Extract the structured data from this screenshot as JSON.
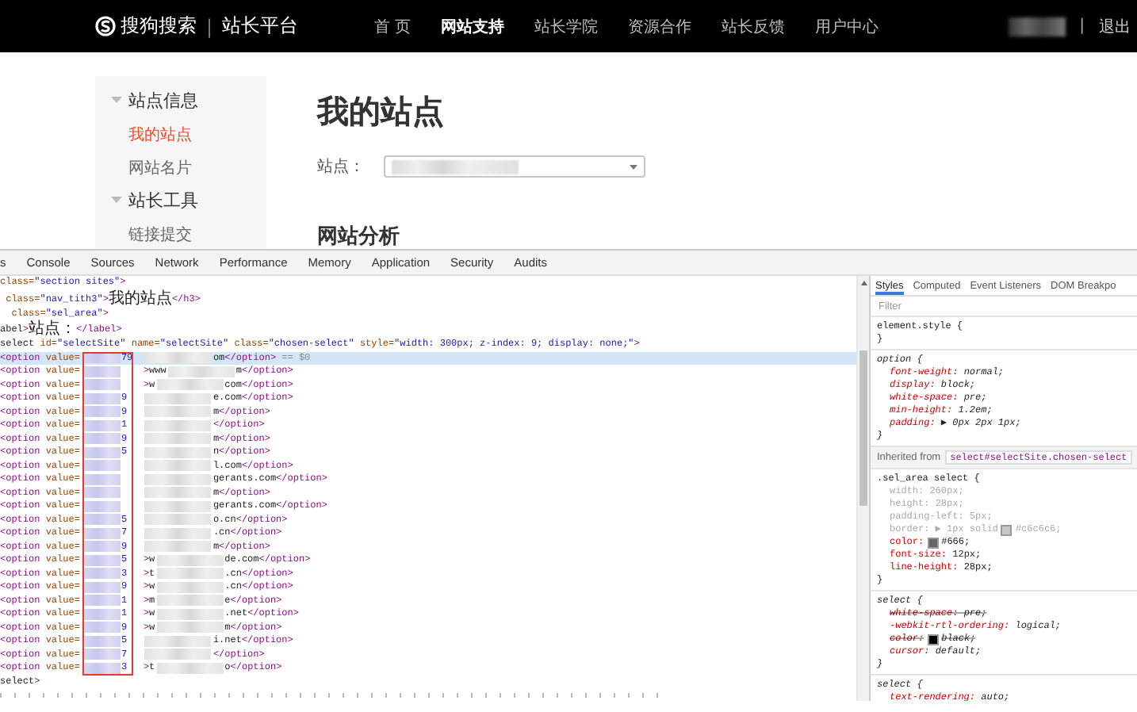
{
  "topbar": {
    "logo_text": "搜狗搜索",
    "divider": "|",
    "platform": "站长平台",
    "nav": [
      {
        "label": "首 页",
        "selected": false
      },
      {
        "label": "网站支持",
        "selected": true
      },
      {
        "label": "站长学院",
        "selected": false
      },
      {
        "label": "资源合作",
        "selected": false
      },
      {
        "label": "站长反馈",
        "selected": false
      },
      {
        "label": "用户中心",
        "selected": false
      }
    ],
    "separator": "|",
    "logout": "退出"
  },
  "sidebar": {
    "sections": [
      {
        "title": "站点信息",
        "expanded": true,
        "items": [
          {
            "label": "我的站点",
            "selected": true
          },
          {
            "label": "网站名片",
            "selected": false
          }
        ]
      },
      {
        "title": "站长工具",
        "expanded": true,
        "items": [
          {
            "label": "链接提交",
            "selected": false
          }
        ]
      }
    ]
  },
  "main": {
    "title": "我的站点",
    "site_label": "站点：",
    "analysis_title": "网站分析"
  },
  "devtools": {
    "tabs": [
      {
        "label": "s",
        "selected": false
      },
      {
        "label": "Console",
        "selected": false
      },
      {
        "label": "Sources",
        "selected": false
      },
      {
        "label": "Network",
        "selected": false
      },
      {
        "label": "Performance",
        "selected": false
      },
      {
        "label": "Memory",
        "selected": false
      },
      {
        "label": "Application",
        "selected": false
      },
      {
        "label": "Security",
        "selected": false
      },
      {
        "label": "Audits",
        "selected": false
      }
    ],
    "code_lines": [
      "class=\"section sites\">",
      " class=\"nav_tith3\">我的站点</h3>",
      "  class=\"sel_area\">",
      "abel>站点：</label>",
      "select id=\"selectSite\" name=\"selectSite\" class=\"chosen-select\" style=\"width: 300px; z-index: 9; display: none;\">"
    ],
    "options": [
      {
        "open": "<option value=",
        "value_end": "79",
        "text_end": "om</option> == $0",
        "selected": true
      },
      {
        "open": "<option value=",
        "text_start": ">www",
        "text_end": "m</option>",
        "selected": false
      },
      {
        "open": "<option value=",
        "text_start": ">w",
        "text_end": "com</option>",
        "selected": false
      },
      {
        "open": "<option value=",
        "value_end": "9",
        "text_end": "e.com</option>",
        "selected": false
      },
      {
        "open": "<option value=",
        "value_end": "9",
        "text_end": "m</option>",
        "selected": false
      },
      {
        "open": "<option value=",
        "value_end": "1",
        "text_end": "</option>",
        "selected": false
      },
      {
        "open": "<option value=",
        "value_end": "9",
        "text_end": "m</option>",
        "selected": false
      },
      {
        "open": "<option value=",
        "value_end": "5",
        "text_end": "n</option>",
        "selected": false
      },
      {
        "open": "<option value=",
        "text_end": "l.com</option>",
        "selected": false
      },
      {
        "open": "<option value=",
        "text_end": "gerants.com</option>",
        "selected": false
      },
      {
        "open": "<option value=",
        "text_end": "m</option>",
        "selected": false
      },
      {
        "open": "<option value=",
        "text_end": "gerants.com</option>",
        "selected": false
      },
      {
        "open": "<option value=",
        "value_end": "5",
        "text_end": "o.cn</option>",
        "selected": false
      },
      {
        "open": "<option value=",
        "value_end": "7",
        "text_end": ".cn</option>",
        "selected": false
      },
      {
        "open": "<option value=",
        "value_end": "9",
        "text_end": "m</option>",
        "selected": false
      },
      {
        "open": "<option value=",
        "value_end": "5",
        "text_start": ">w",
        "text_end": "de.com</option>",
        "selected": false
      },
      {
        "open": "<option value=",
        "value_end": "3",
        "text_start": ">t",
        "text_end": ".cn</option>",
        "selected": false
      },
      {
        "open": "<option value=",
        "value_end": "9",
        "text_start": ">w",
        "text_end": ".cn</option>",
        "selected": false
      },
      {
        "open": "<option value=",
        "value_end": "1",
        "text_start": ">m",
        "text_end": "e</option>",
        "selected": false
      },
      {
        "open": "<option value=",
        "value_end": "1",
        "text_start": ">w",
        "text_end": ".net</option>",
        "selected": false
      },
      {
        "open": "<option value=",
        "value_end": "9",
        "text_start": ">w",
        "text_end": "m</option>",
        "selected": false
      },
      {
        "open": "<option value=",
        "value_end": "5",
        "text_end": "i.net</option>",
        "selected": false
      },
      {
        "open": "<option value=",
        "value_end": "7",
        "text_end": "</option>",
        "selected": false
      },
      {
        "open": "<option value=",
        "value_end": "3",
        "text_start": ">t",
        "text_end": "o</option>",
        "selected": false
      }
    ],
    "closing_line": "select>",
    "style_tabs": [
      {
        "label": "Styles",
        "selected": true
      },
      {
        "label": "Computed",
        "selected": false
      },
      {
        "label": "Event Listeners",
        "selected": false
      },
      {
        "label": "DOM Breakpo",
        "selected": false
      }
    ],
    "filter_placeholder": "Filter",
    "rules": [
      {
        "kind": "inline",
        "selector": "element.style {",
        "close": "}"
      },
      {
        "kind": "user-agent",
        "selector": "option {",
        "close": "}",
        "declarations": [
          {
            "text": "font-weight: normal;",
            "inactive": false,
            "overridden": false
          },
          {
            "text": "display: block;",
            "inactive": false,
            "overridden": false
          },
          {
            "text": "white-space: pre;",
            "inactive": false,
            "overridden": false
          },
          {
            "text": "min-height: 1.2em;",
            "inactive": false,
            "overridden": false
          },
          {
            "text": "padding: ▶ 0px 2px 1px;",
            "inactive": false,
            "overridden": false
          }
        ]
      },
      {
        "kind": "inherited",
        "label": "Inherited from",
        "selector": "select#selectSite.chosen-select"
      },
      {
        "kind": "author",
        "selector": ".sel_area select {",
        "close": "}",
        "declarations": [
          {
            "text": "width: 260px;",
            "inactive": true,
            "overridden": false
          },
          {
            "text": "height: 28px;",
            "inactive": true,
            "overridden": false
          },
          {
            "text": "padding-left: 5px;",
            "inactive": true,
            "overridden": false
          },
          {
            "before": "border: ▶ 1px solid",
            "color": "#c6c6c6",
            "after": "#c6c6c6;",
            "inactive": true,
            "overridden": false
          },
          {
            "before": "color:",
            "color": "#666666",
            "after": "#666;",
            "inactive": false,
            "overridden": false
          },
          {
            "text": "font-size: 12px;",
            "inactive": false,
            "overridden": false
          },
          {
            "text": "line-height: 28px;",
            "inactive": false,
            "overridden": false
          }
        ]
      },
      {
        "kind": "user-agent",
        "selector": "select {",
        "close": "}",
        "declarations": [
          {
            "text": "white-space: pre;",
            "inactive": false,
            "overridden": true
          },
          {
            "text": "-webkit-rtl-ordering: logical;",
            "inactive": false,
            "overridden": false
          },
          {
            "before": "color:",
            "color": "#000000",
            "after": "black;",
            "inactive": false,
            "overridden": true
          },
          {
            "text": "cursor: default;",
            "inactive": false,
            "overridden": false
          }
        ]
      },
      {
        "kind": "user-agent",
        "selector": "select {",
        "declarations": [
          {
            "text": "text-rendering: auto;",
            "inactive": false,
            "overridden": false
          }
        ]
      }
    ]
  }
}
